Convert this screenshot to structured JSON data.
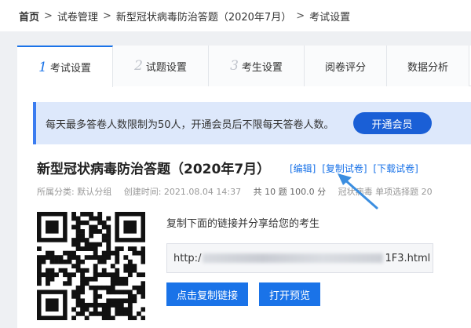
{
  "breadcrumb": {
    "home": "首页",
    "separator": ">",
    "level2": "试卷管理",
    "level3": "新型冠状病毒防治答题（2020年7月）",
    "current": "考试设置"
  },
  "tabs": [
    {
      "num": "1",
      "label": "考试设置"
    },
    {
      "num": "2",
      "label": "试题设置"
    },
    {
      "num": "3",
      "label": "考生设置"
    },
    {
      "label": "阅卷评分"
    },
    {
      "label": "数据分析"
    }
  ],
  "notice": {
    "text": "每天最多答卷人数限制为50人，开通会员后不限每天答卷人数。",
    "button": "开通会员"
  },
  "exam": {
    "title": "新型冠状病毒防治答题（2020年7月）",
    "edit": "[编辑]",
    "copy": "[复制试卷]",
    "download": "[下载试卷]"
  },
  "meta": {
    "category": "所属分类: 默认分组",
    "created": "创建时间: 2021.08.04 14:37",
    "questions": "共 10 题 100.0 分",
    "tags": "冠状病毒 单项选择题 20"
  },
  "share": {
    "prompt": "复制下面的链接并分享给您的考生",
    "url_prefix": "http:/",
    "url_suffix": "1F3.html",
    "copy_button": "点击复制链接",
    "preview_button": "打开预览"
  },
  "colors": {
    "accent": "#1a73e8",
    "notice_bg": "#dde8fb",
    "arrow": "#3b8ee0"
  }
}
